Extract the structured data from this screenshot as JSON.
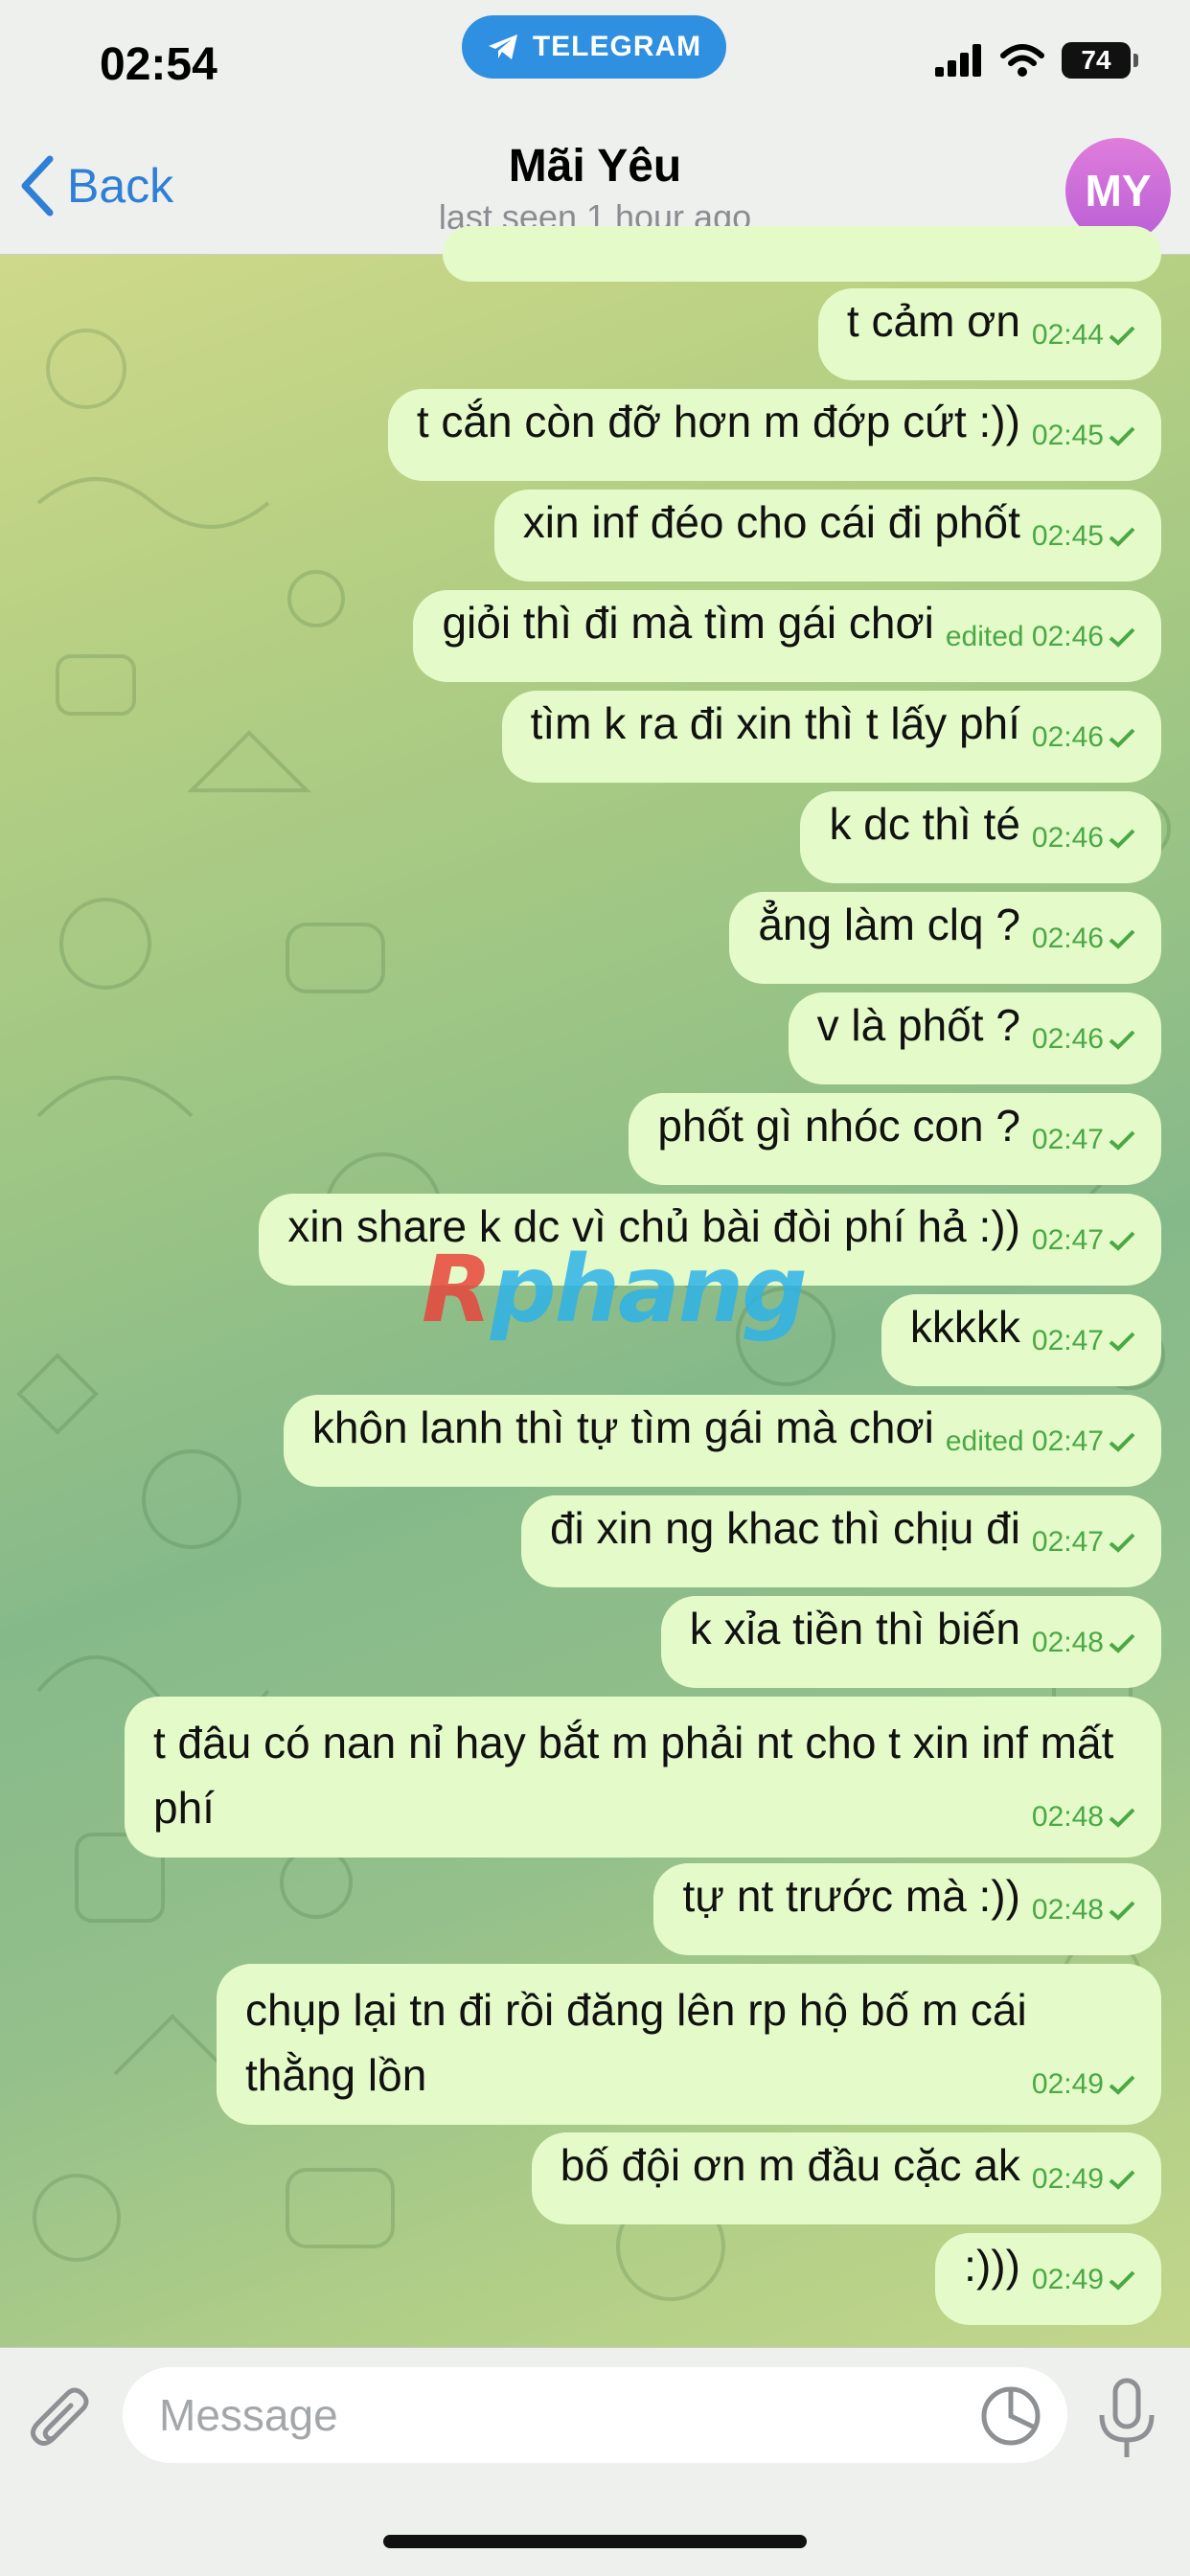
{
  "status_bar": {
    "time": "02:54",
    "pill_label": "TELEGRAM",
    "battery": "74"
  },
  "header": {
    "back_label": "Back",
    "title": "Mãi Yêu",
    "subtitle": "last seen 1 hour ago",
    "avatar_initials": "MY"
  },
  "messages": [
    {
      "text": "t cảm ơn",
      "time": "02:44",
      "edited": false
    },
    {
      "text": "t cắn còn đỡ hơn m đớp cứt :))",
      "time": "02:45",
      "edited": false
    },
    {
      "text": "xin inf đéo cho cái đi phốt",
      "time": "02:45",
      "edited": false
    },
    {
      "text": "giỏi thì đi mà tìm gái chơi",
      "time": "edited 02:46",
      "edited": true
    },
    {
      "text": "tìm k ra đi xin thì t lấy phí",
      "time": "02:46",
      "edited": false
    },
    {
      "text": "k dc thì té",
      "time": "02:46",
      "edited": false
    },
    {
      "text": "ẳng làm clq ?",
      "time": "02:46",
      "edited": false
    },
    {
      "text": "v là phốt ?",
      "time": "02:46",
      "edited": false
    },
    {
      "text": "phốt gì nhóc con ?",
      "time": "02:47",
      "edited": false
    },
    {
      "text": "xin share k dc vì chủ bài đòi phí hả :))",
      "time": "02:47",
      "edited": false
    },
    {
      "text": "kkkkk",
      "time": "02:47",
      "edited": false
    },
    {
      "text": "khôn lanh thì tự tìm gái mà chơi",
      "time": "edited 02:47",
      "edited": true
    },
    {
      "text": "đi xin ng khac thì chịu đi",
      "time": "02:47",
      "edited": false
    },
    {
      "text": "k xỉa tiền thì biến",
      "time": "02:48",
      "edited": false
    },
    {
      "text": "t đâu có nan nỉ hay bắt m phải nt cho t xin inf mất phí",
      "time": "02:48",
      "edited": false
    },
    {
      "text": "tự nt trước mà :))",
      "time": "02:48",
      "edited": false
    },
    {
      "text": "chụp lại tn đi rồi đăng lên rp hộ bố m cái thằng lồn",
      "time": "02:49",
      "edited": false
    },
    {
      "text": "bố đội ơn m đầu cặc ak",
      "time": "02:49",
      "edited": false
    },
    {
      "text": ":)))",
      "time": "02:49",
      "edited": false
    }
  ],
  "watermark": {
    "first_letter": "R",
    "rest": "phang"
  },
  "input": {
    "placeholder": "Message"
  },
  "icons": {
    "back": "chevron-left-icon",
    "attach": "paperclip-icon",
    "sticker": "sticker-icon",
    "mic": "microphone-icon",
    "read": "check-icon"
  },
  "colors": {
    "bubble": "#e4fbc9",
    "meta": "#4aa845",
    "accent": "#2f7fd6",
    "pill": "#2f8fe0"
  }
}
